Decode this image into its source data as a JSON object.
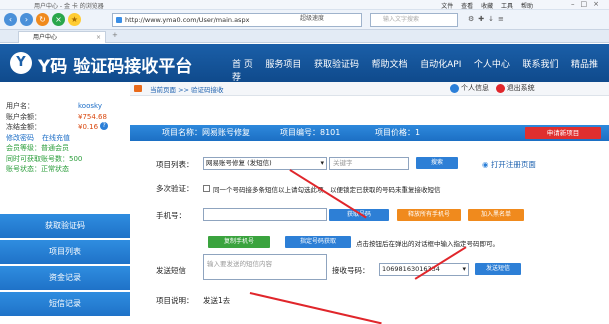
{
  "window": {
    "title": "用户中心 - 金 卡 的浏览器",
    "menu": [
      "文件",
      "查看",
      "收藏",
      "工具",
      "帮助"
    ]
  },
  "toolbar": {
    "address": "http://www.yma0.com/User/main.aspx",
    "addr_right": "超级速度",
    "search_placeholder": "输入文字搜索"
  },
  "tabs": [
    {
      "label": "用户中心"
    }
  ],
  "site": {
    "logo_mark": "Y",
    "logo_text": "Y码 验证码接收平台",
    "nav": [
      "首 页",
      "服务项目",
      "获取验证码",
      "帮助文档",
      "自动化API",
      "个人中心",
      "联系我们",
      "精品推荐"
    ]
  },
  "breadcrumb": {
    "text": "当前页面 >> 验证码接收",
    "user_info": "个人信息",
    "logout": "退出系统"
  },
  "account": {
    "username_label": "用户名：",
    "username": "koosky",
    "balance_label": "账户余额：",
    "balance": "¥754.68",
    "frozen_label": "冻结金额：",
    "frozen": "¥0.16",
    "change_pwd": "修改密码",
    "online_recharge": "在线充值",
    "member_level_label": "会员等级：",
    "member_level": "普通会员",
    "concurrent_label": "同时可获取账号数：",
    "concurrent": "500",
    "status_label": "账号状态：",
    "status": "正常状态"
  },
  "side_menu": [
    "获取验证码",
    "项目列表",
    "资金记录",
    "短信记录"
  ],
  "project": {
    "name": "项目名称：网易账号修复",
    "id": "项目编号：8101",
    "price": "项目价格：1",
    "new_button": "申请新项目"
  },
  "form": {
    "project_list_label": "项目列表：",
    "project_selected": "网易账号修复 (发短信)",
    "keyword_placeholder": "关键字",
    "search_button": "搜索",
    "open_page_link": "打开注册页面",
    "multi_receive_label": "多次验证：",
    "multi_receive_text": "同一个号码接多条短信以上请勾选此项，以便锁定已获取的号码未重复接收短信",
    "phone_label": "手机号：",
    "get_number_button": "获取号码",
    "release_all_button": "释放所有手机号",
    "blacklist_button": "加入黑名单",
    "copy_phone_button": "复制手机号",
    "specify_button": "指定号码获取",
    "specify_hint": "点击按钮后在弹出的对话框中输入指定号码即可。",
    "send_sms_label": "发送短信",
    "send_sms_placeholder": "输入要发送的短信内容",
    "receiver_label": "接收号码：",
    "receiver_value": "10698163016334",
    "send_button": "发送短信",
    "project_desc_label": "项目说明：",
    "project_desc": "发送1去"
  }
}
